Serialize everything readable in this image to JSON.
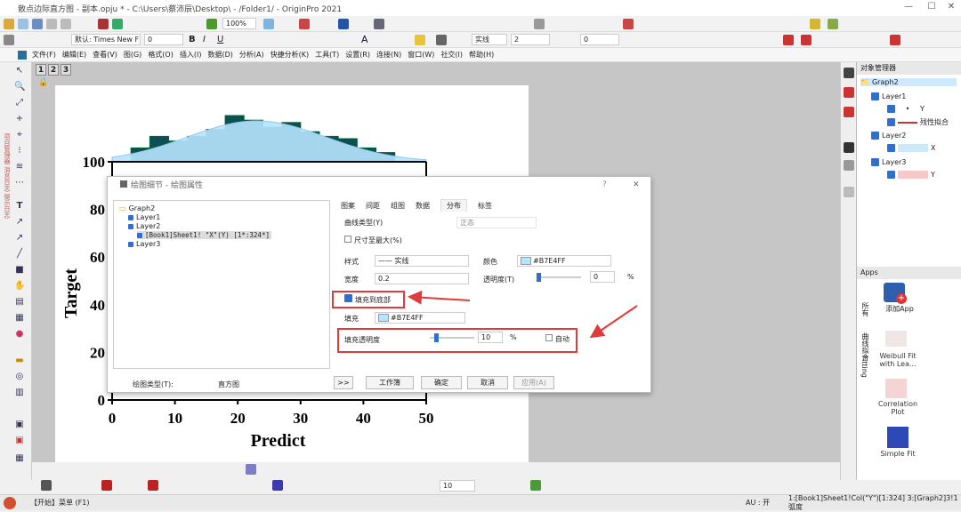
{
  "window": {
    "title": "散点边际直方图 - 副本.opju * - C:\\Users\\蔡沛辰\\Desktop\\ - /Folder1/ - OriginPro 2021"
  },
  "toolbar": {
    "zoom": "100%",
    "font_name": "默认: Times New F",
    "font_size": "0",
    "line_style": "实线",
    "line_width": "2",
    "fill_size": "0",
    "last_size": "10"
  },
  "menu": [
    "文件(F)",
    "编辑(E)",
    "查看(V)",
    "图(G)",
    "格式(O)",
    "插入(I)",
    "数据(D)",
    "分析(A)",
    "快捷分析(K)",
    "工具(T)",
    "设置(R)",
    "连接(N)",
    "窗口(W)",
    "社交(I)",
    "帮助(H)"
  ],
  "side_tabs": "项目管理器 消息日志 提示日志",
  "page_tabs": [
    "1",
    "2",
    "3"
  ],
  "chart_data": {
    "type": "bar",
    "xlabel": "Predict",
    "ylabel": "Target",
    "x_ticks": [
      "0",
      "10",
      "20",
      "30",
      "40",
      "50"
    ],
    "y_ticks": [
      "0",
      "20",
      "40",
      "60",
      "80",
      "100"
    ],
    "xlim": [
      0,
      50
    ],
    "ylim": [
      0,
      100
    ],
    "histogram_bars": [
      {
        "x0": 3,
        "x1": 6,
        "h": 0.3
      },
      {
        "x0": 6,
        "x1": 9,
        "h": 0.55
      },
      {
        "x0": 9,
        "x1": 12,
        "h": 0.45
      },
      {
        "x0": 12,
        "x1": 15,
        "h": 0.55
      },
      {
        "x0": 15,
        "x1": 18,
        "h": 0.7
      },
      {
        "x0": 18,
        "x1": 21,
        "h": 1.0
      },
      {
        "x0": 21,
        "x1": 24,
        "h": 0.9
      },
      {
        "x0": 24,
        "x1": 27,
        "h": 0.75
      },
      {
        "x0": 27,
        "x1": 30,
        "h": 0.85
      },
      {
        "x0": 30,
        "x1": 33,
        "h": 0.65
      },
      {
        "x0": 33,
        "x1": 36,
        "h": 0.55
      },
      {
        "x0": 36,
        "x1": 39,
        "h": 0.5
      },
      {
        "x0": 39,
        "x1": 42,
        "h": 0.3
      },
      {
        "x0": 42,
        "x1": 45,
        "h": 0.2
      }
    ],
    "fill_color": "#B7E4FF",
    "bar_color": "#0d4f52"
  },
  "dialog": {
    "title": "绘图细节 - 绘图属性",
    "tree": {
      "root": "Graph2",
      "layer1": "Layer1",
      "layer2": "Layer2",
      "plot": "[Book1]Sheet1! \"X\"(Y) [1*:324*]",
      "layer3": "Layer3"
    },
    "tabs": [
      "图案",
      "间距",
      "组图",
      "数据",
      "分布",
      "标签"
    ],
    "curve_type_label": "曲线类型(Y)",
    "curve_type": "正态",
    "size_max": "尺寸至最大(%)",
    "style_label": "样式",
    "style": "—— 实线",
    "color_label": "颜色",
    "color": "#B7E4FF",
    "width_label": "宽度",
    "width": "0.2",
    "trans_label": "透明度(T)",
    "trans": "0",
    "fill_to_bottom": "填充到底部",
    "fill_label": "填充",
    "fill": "#B7E4FF",
    "fill_trans_label": "填充透明度",
    "fill_trans": "10",
    "auto": "自动",
    "pct": "%",
    "plot_type_label": "绘图类型(T):",
    "plot_type": "直方图",
    "buttons": {
      "more": ">>",
      "workbook": "工作簿",
      "ok": "确定",
      "cancel": "取消",
      "apply": "应用(A)"
    }
  },
  "object_manager": {
    "title": "对象管理器",
    "graph": "Graph2",
    "layer1": "Layer1",
    "y1": "Y",
    "fit": "残性拟合",
    "layer2": "Layer2",
    "x": "X",
    "layer3": "Layer3",
    "y3": "Y"
  },
  "apps": {
    "title": "Apps",
    "tab1": "所有",
    "tab2": "曲线拟合",
    "tab3": "Fitting",
    "add": "添加App",
    "weibull": "Weibull Fit with Lea...",
    "corr": "Correlation Plot",
    "simple": "Simple Fit"
  },
  "status": {
    "start": "【开始】菜单 (F1)",
    "au": "AU : 开",
    "info": "1:[Book1]Sheet1!Col(\"Y\")[1:324] 3:[Graph2]3!1 弧度"
  }
}
